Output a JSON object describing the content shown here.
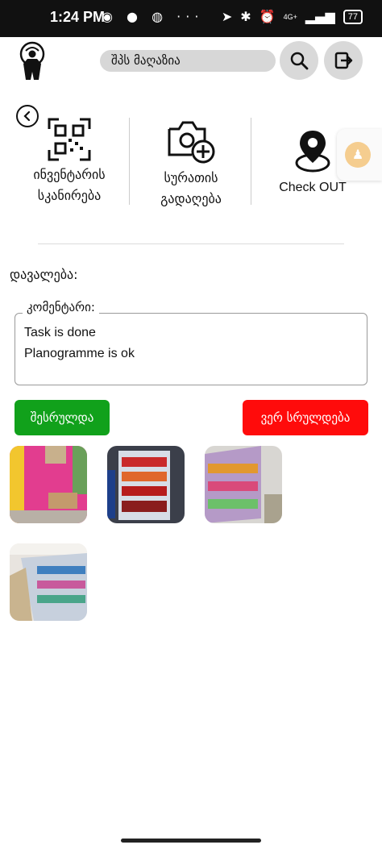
{
  "status_bar": {
    "time": "1:24 PM",
    "left_icons": "◉ ● ◍ ···",
    "network": "4G+",
    "battery": "77"
  },
  "header": {
    "search_placeholder": "შპს მაღაზია"
  },
  "actions": [
    {
      "label_line1": "ინვენტარის",
      "label_line2": "სკანირება"
    },
    {
      "label_line1": "სურათის",
      "label_line2": "გადაღება"
    },
    {
      "label_line1": "Check OUT",
      "label_line2": ""
    }
  ],
  "task": {
    "label": "დავალება:",
    "comment_label": "კომენტარი:",
    "comment_lines": [
      "Task is done",
      "Planogramme is ok"
    ]
  },
  "buttons": {
    "done": "შესრულდა",
    "not_done": "ვერ სრულდება"
  },
  "colors": {
    "done_button": "#11a11b",
    "not_done_button": "#ff0b0b",
    "side_tab_accent": "#f5cd8f"
  },
  "photos": [
    {
      "icon": "photo-store-exterior"
    },
    {
      "icon": "photo-drinks-fridge"
    },
    {
      "icon": "photo-shelf-snacks"
    },
    {
      "icon": "photo-shelf-aisle"
    }
  ]
}
